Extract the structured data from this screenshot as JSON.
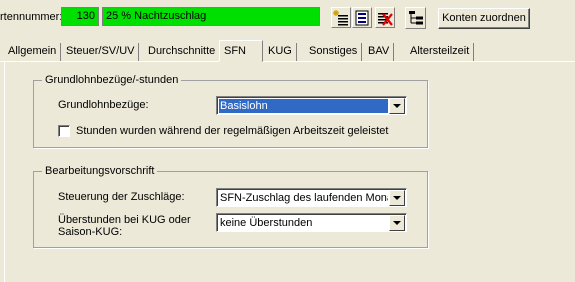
{
  "header": {
    "field_label": "rtennummer:",
    "number_value": "130",
    "name_value": "25 % Nachtzuschlag",
    "konten_button": "Konten zuordnen"
  },
  "tabs": [
    {
      "label": "Allgemein"
    },
    {
      "label": "Steuer/SV/UV"
    },
    {
      "label": "Durchschnitte"
    },
    {
      "label": "SFN"
    },
    {
      "label": "KUG"
    },
    {
      "label": "Sonstiges"
    },
    {
      "label": "BAV"
    },
    {
      "label": "Altersteilzeit"
    }
  ],
  "group1": {
    "title": "Grundlohnbezüge/-stunden",
    "grundlohn_label": "Grundlohnbezüge:",
    "grundlohn_value": "Basislohn",
    "checkbox_label": "Stunden wurden während der regelmäßigen Arbeitszeit geleistet"
  },
  "group2": {
    "title": "Bearbeitungsvorschrift",
    "steuerung_label": "Steuerung der Zuschläge:",
    "steuerung_value": "SFN-Zuschlag des laufenden Monats",
    "ueberstunden_label_1": "Überstunden bei KUG oder",
    "ueberstunden_label_2": "Saison-KUG:",
    "ueberstunden_value": "keine Überstunden"
  },
  "colors": {
    "highlight_green": "#00e000",
    "selection_blue": "#316ac5",
    "window_bg": "#ece9d8"
  },
  "icons": [
    "list-add-icon",
    "list-view-icon",
    "delete-icon",
    "tree-structure-icon",
    "chevron-down-icon"
  ]
}
